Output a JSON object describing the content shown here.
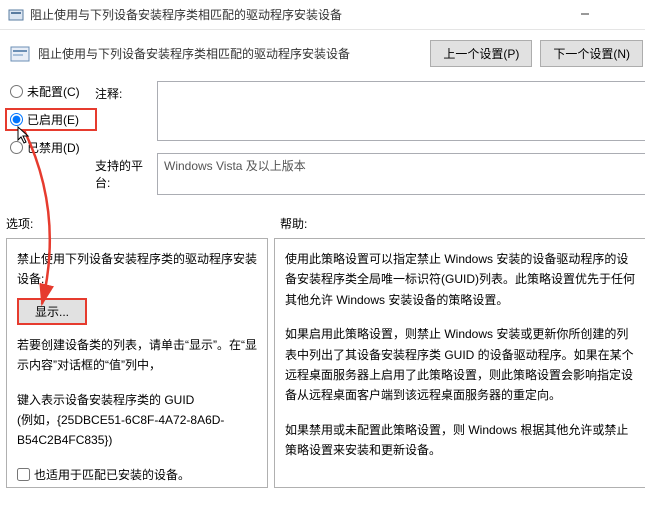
{
  "window": {
    "title": "阻止使用与下列设备安装程序类相匹配的驱动程序安装设备"
  },
  "header": {
    "title": "阻止使用与下列设备安装程序类相匹配的驱动程序安装设备",
    "prev": "上一个设置(P)",
    "next": "下一个设置(N)"
  },
  "radios": {
    "not_configured": "未配置(C)",
    "enabled": "已启用(E)",
    "disabled": "已禁用(D)"
  },
  "fields": {
    "comment_label": "注释:",
    "platform_label": "支持的平台:",
    "platform_value": "Windows Vista 及以上版本"
  },
  "labels": {
    "options": "选项:",
    "help": "帮助:"
  },
  "left_panel": {
    "line1": "禁止使用下列设备安装程序类的驱动程序安装设备:",
    "show": "显示...",
    "line2": "若要创建设备类的列表，请单击“显示”。在“显示内容”对话框的“值”列中，",
    "line3": "键入表示设备安装程序类的 GUID",
    "line4": "(例如，{25DBCE51-6C8F-4A72-8A6D-B54C2B4FC835})",
    "checkbox": "也适用于匹配已安装的设备。"
  },
  "right_panel": {
    "p1": "使用此策略设置可以指定禁止 Windows 安装的设备驱动程序的设备安装程序类全局唯一标识符(GUID)列表。此策略设置优先于任何其他允许 Windows 安装设备的策略设置。",
    "p2": "如果启用此策略设置，则禁止 Windows 安装或更新你所创建的列表中列出了其设备安装程序类 GUID 的设备驱动程序。如果在某个远程桌面服务器上启用了此策略设置，则此策略设置会影响指定设备从远程桌面客户端到该远程桌面服务器的重定向。",
    "p3": "如果禁用或未配置此策略设置，则 Windows 根据其他允许或禁止策略设置来安装和更新设备。"
  }
}
